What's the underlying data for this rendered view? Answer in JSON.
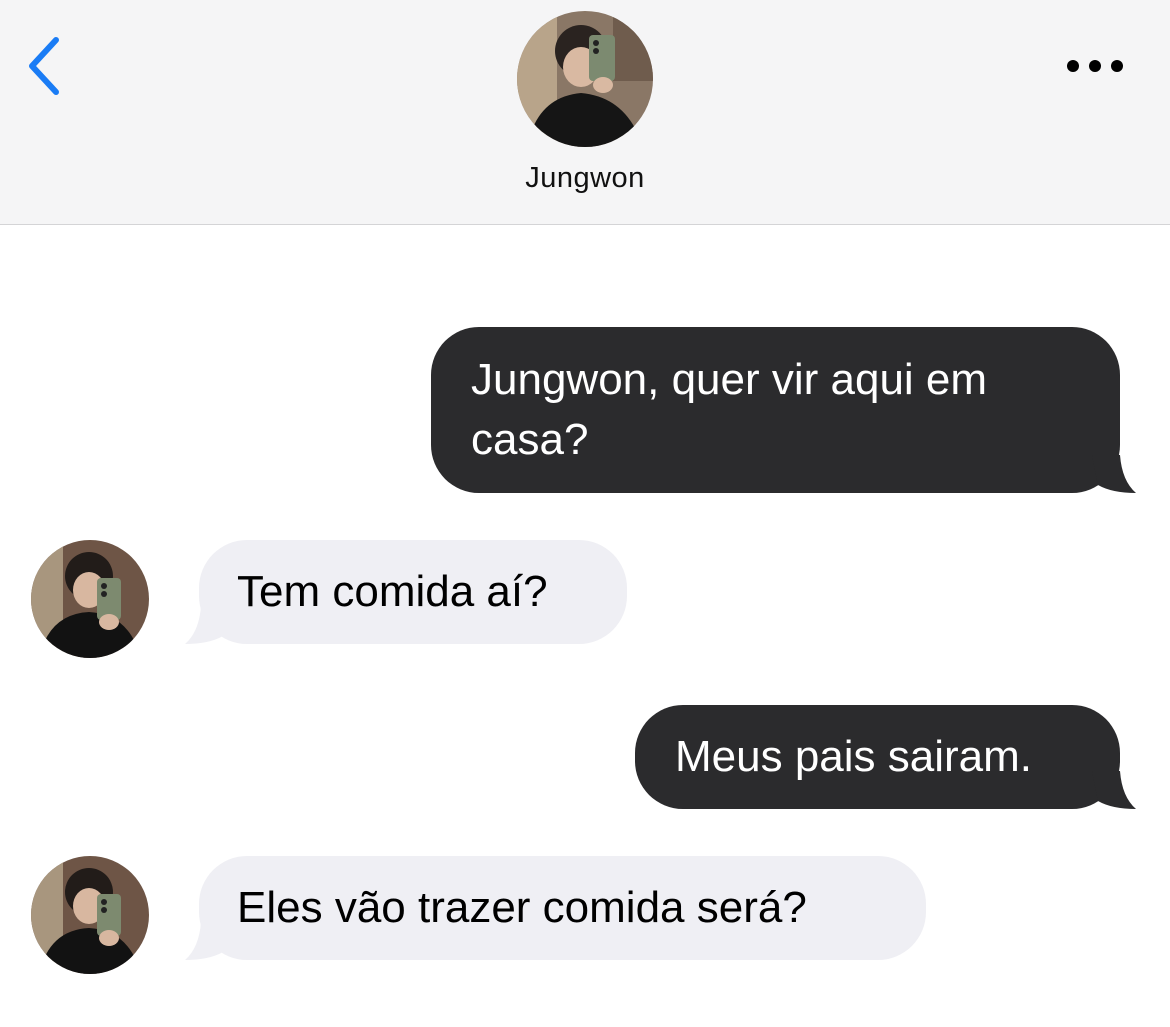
{
  "header": {
    "back_icon": "chevron-left-icon",
    "contact_name": "Jungwon",
    "more_icon": "ellipsis-icon",
    "accent_color": "#1a7cf5"
  },
  "messages": [
    {
      "direction": "sent",
      "text": "Jungwon, quer vir aqui em casa?"
    },
    {
      "direction": "received",
      "text": "Tem comida aí?"
    },
    {
      "direction": "sent",
      "text": "Meus pais sairam."
    },
    {
      "direction": "received",
      "text": "Eles vão trazer comida será?"
    }
  ],
  "colors": {
    "sent_bubble": "#2b2b2d",
    "received_bubble": "#efeff4",
    "header_bg": "#f5f5f6"
  }
}
